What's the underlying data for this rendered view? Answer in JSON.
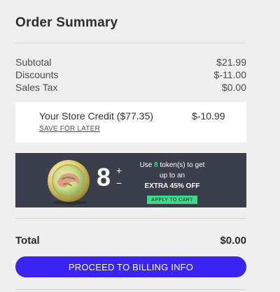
{
  "summary": {
    "title": "Order Summary",
    "lines": [
      {
        "label": "Subtotal",
        "value": "$21.99"
      },
      {
        "label": "Discounts",
        "value": "$-11.00"
      },
      {
        "label": "Sales Tax",
        "value": "$0.00"
      }
    ]
  },
  "credit": {
    "label": "Your Store Credit ($77.35)",
    "value": "$-10.99",
    "save_later": "SAVE FOR LATER"
  },
  "promo": {
    "token_count": "8",
    "plus": "+",
    "minus": "−",
    "text_use": "Use ",
    "text_tokens": "8",
    "text_tokens_suffix": " token(s) to get",
    "text_up_to": "up to an",
    "text_extra": "EXTRA 45% OFF",
    "apply_label": "APPLY TO CART",
    "accent_color": "#3fd88a",
    "background_color": "#3a3f4b",
    "icon": "token-coin-icon"
  },
  "total": {
    "label": "Total",
    "value": "$0.00"
  },
  "proceed": {
    "label": "PROCEED TO BILLING INFO",
    "color": "#3a24f2"
  }
}
